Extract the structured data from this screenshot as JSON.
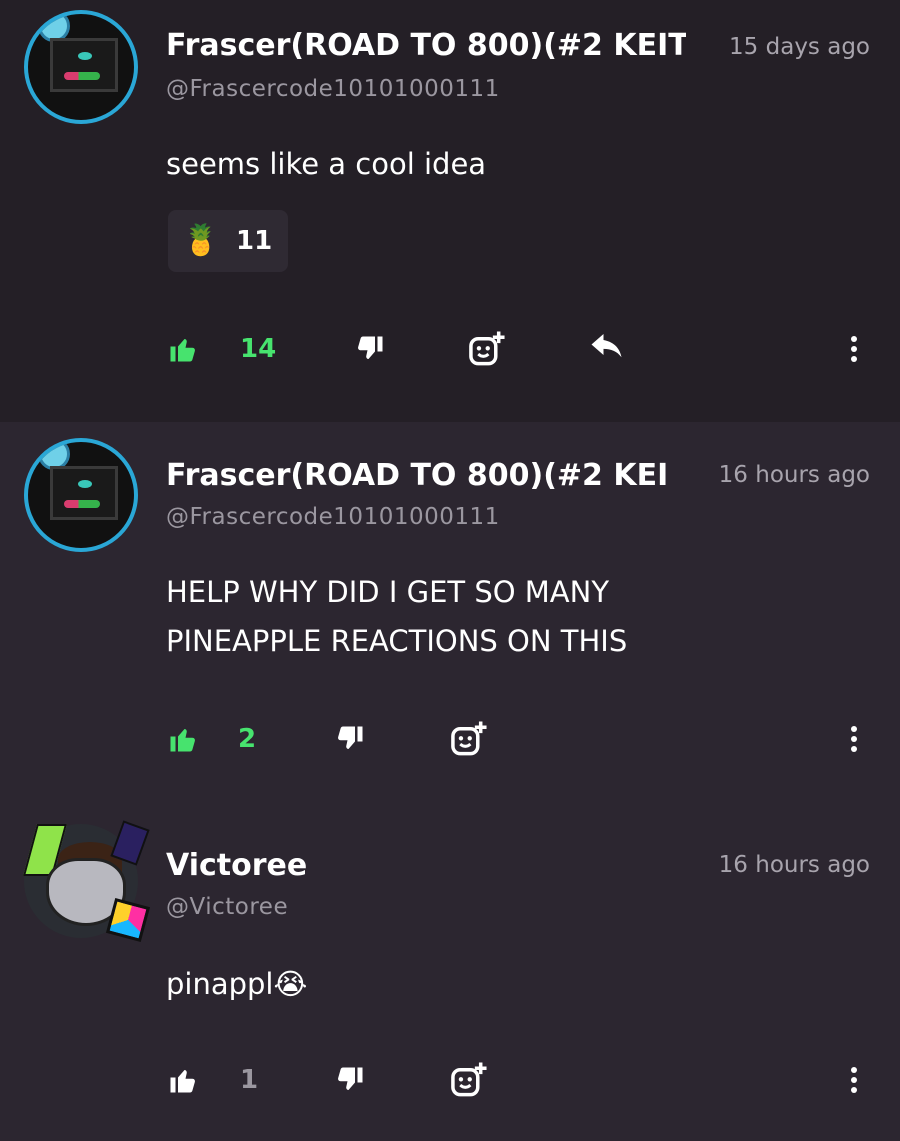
{
  "comments": [
    {
      "name": "Frascer(ROAD TO 800)(#2 KEIT",
      "handle": "@Frascercode10101000111",
      "time": "15 days ago",
      "text": "seems like a cool idea",
      "reaction": {
        "emoji": "🍍",
        "count": "11"
      },
      "likes": "14",
      "liked": true,
      "avatar_icon": "robot-avatar-icon"
    },
    {
      "name": "Frascer(ROAD TO 800)(#2 KEI",
      "handle": "@Frascercode10101000111",
      "time": "16 hours ago",
      "text_line1": "HELP WHY DID I GET SO MANY",
      "text_line2": "PINEAPPLE REACTIONS ON THIS",
      "likes": "2",
      "liked": true,
      "avatar_icon": "robot-avatar-icon"
    },
    {
      "name": "Victoree",
      "handle": "@Victoree",
      "time": "16 hours ago",
      "text": "pinappl",
      "text_emoji": "😭",
      "likes": "1",
      "liked": false,
      "avatar_icon": "cat-avatar-icon"
    }
  ],
  "colors": {
    "like_active": "#47e36e",
    "text_secondary": "#9b97a0",
    "background": "#28232b"
  },
  "icons": [
    "thumbs-up-icon",
    "thumbs-down-icon",
    "add-reaction-icon",
    "reply-icon",
    "more-options-icon"
  ]
}
